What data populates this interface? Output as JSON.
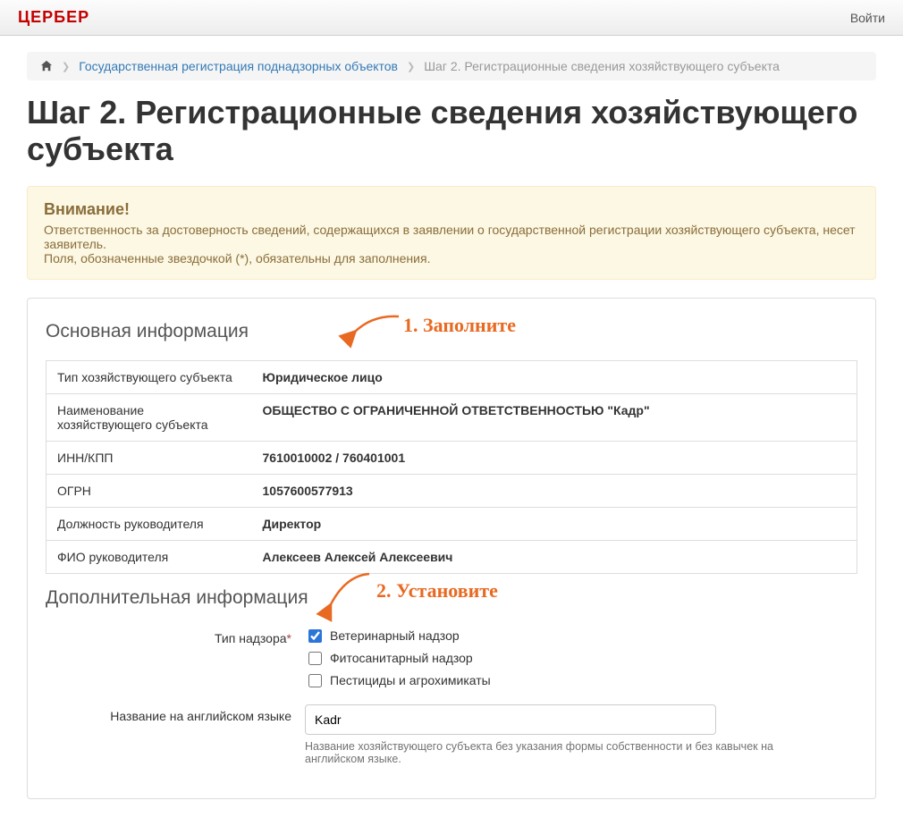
{
  "navbar": {
    "brand": "ЦЕРБЕР",
    "login": "Войти"
  },
  "breadcrumb": {
    "link1": "Государственная регистрация поднадзорных объектов",
    "current": "Шаг 2. Регистрационные сведения хозяйствующего субъекта"
  },
  "page_title": "Шаг 2. Регистрационные сведения хозяйствующего субъекта",
  "alert": {
    "title": "Внимание!",
    "line1": "Ответственность за достоверность сведений, содержащихся в заявлении о государственной регистрации хозяйствующего субъекта, несет заявитель.",
    "line2": "Поля, обозначенные звездочкой (*), обязательны для заполнения."
  },
  "sections": {
    "main_info": "Основная информация",
    "extra_info": "Дополнительная информация"
  },
  "info_rows": [
    {
      "label": "Тип хозяйствующего субъекта",
      "value": "Юридическое лицо"
    },
    {
      "label": "Наименование хозяйствующего субъекта",
      "value": "ОБЩЕСТВО С ОГРАНИЧЕННОЙ ОТВЕТСТВЕННОСТЬЮ \"Кадр\""
    },
    {
      "label": "ИНН/КПП",
      "value": "7610010002 / 760401001"
    },
    {
      "label": "ОГРН",
      "value": "1057600577913"
    },
    {
      "label": "Должность руководителя",
      "value": "Директор"
    },
    {
      "label": "ФИО руководителя",
      "value": "Алексеев Алексей Алексеевич"
    }
  ],
  "supervision": {
    "label": "Тип надзора",
    "options": [
      {
        "label": "Ветеринарный надзор",
        "checked": true
      },
      {
        "label": "Фитосанитарный надзор",
        "checked": false
      },
      {
        "label": "Пестициды и агрохимикаты",
        "checked": false
      }
    ]
  },
  "english_name": {
    "label": "Название на английском языке",
    "value": "Kadr",
    "help": "Название хозяйствующего субъекта без указания формы собственности и без кавычек на английском языке."
  },
  "annotations": {
    "a1": "1. Заполните",
    "a2": "2. Установите"
  }
}
